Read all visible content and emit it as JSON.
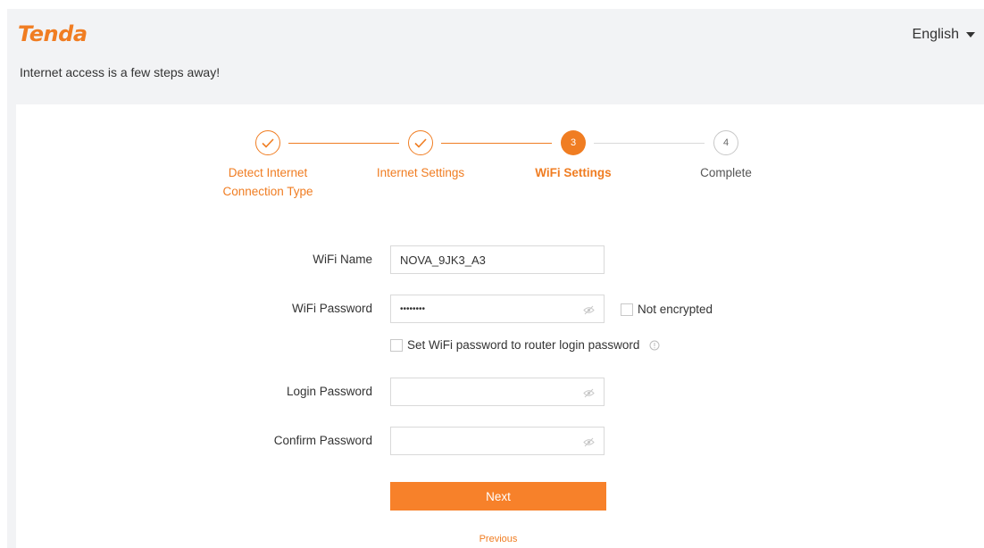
{
  "header": {
    "logo": "Tenda",
    "language": "English",
    "subtitle": "Internet access is a few steps away!"
  },
  "steps": [
    {
      "number": "1",
      "label_line1": "Detect Internet",
      "label_line2": "Connection Type",
      "state": "done"
    },
    {
      "number": "2",
      "label_line1": "Internet Settings",
      "label_line2": "",
      "state": "done"
    },
    {
      "number": "3",
      "label_line1": "WiFi Settings",
      "label_line2": "",
      "state": "active"
    },
    {
      "number": "4",
      "label_line1": "Complete",
      "label_line2": "",
      "state": "todo"
    }
  ],
  "form": {
    "wifi_name_label": "WiFi Name",
    "wifi_name_value": "NOVA_9JK3_A3",
    "wifi_password_label": "WiFi Password",
    "wifi_password_value": "••••••••",
    "not_encrypted_label": "Not encrypted",
    "set_same_password_label": "Set WiFi password to router login password",
    "login_password_label": "Login Password",
    "login_password_value": "",
    "confirm_password_label": "Confirm Password",
    "confirm_password_value": ""
  },
  "actions": {
    "next_label": "Next",
    "previous_label": "Previous"
  },
  "colors": {
    "accent": "#f07d22",
    "background": "#f2f3f5"
  },
  "icons": {
    "eye": "eye-slash-icon",
    "info": "info-icon",
    "check": "check-icon"
  }
}
